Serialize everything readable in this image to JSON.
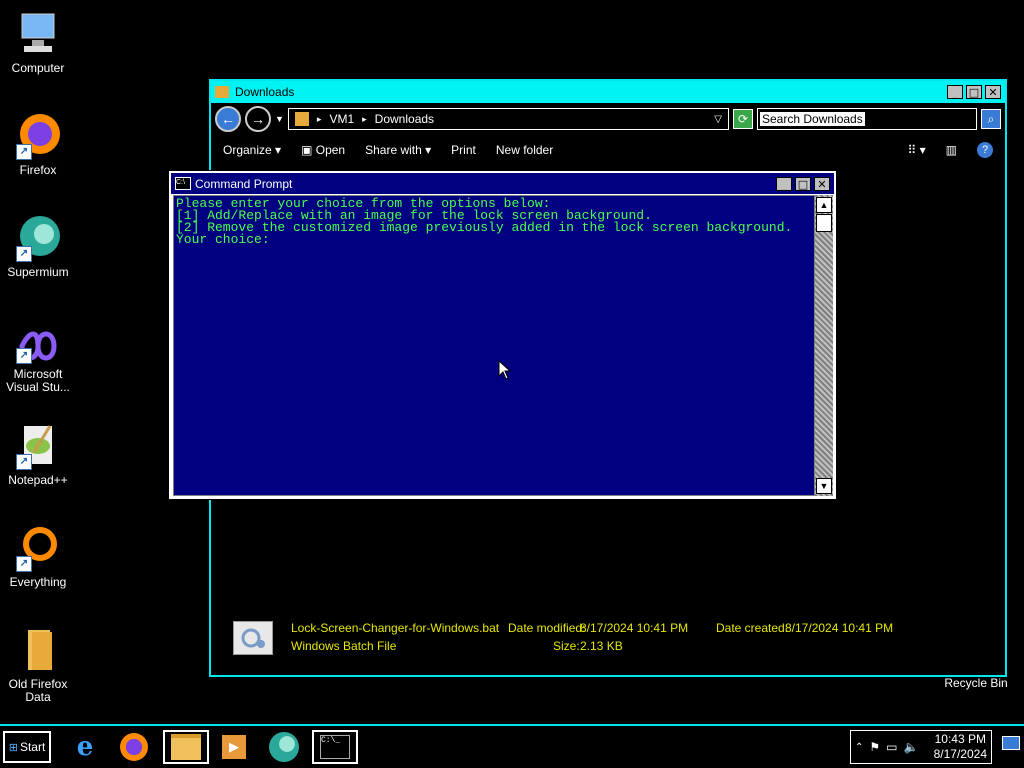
{
  "desktop": {
    "icons": [
      {
        "label": "Computer"
      },
      {
        "label": "Firefox"
      },
      {
        "label": "Supermium"
      },
      {
        "label": "Microsoft Visual Stu..."
      },
      {
        "label": "Notepad++"
      },
      {
        "label": "Everything"
      },
      {
        "label": "Old Firefox Data"
      }
    ],
    "recycle_bin": "Recycle Bin"
  },
  "explorer": {
    "title": "Downloads",
    "breadcrumb": [
      "VM1",
      "Downloads"
    ],
    "search_placeholder": "Search Downloads",
    "toolbar": {
      "organize": "Organize",
      "open": "Open",
      "share": "Share with",
      "print": "Print",
      "new_folder": "New folder"
    },
    "file": {
      "name": "Lock-Screen-Changer-for-Windows.bat",
      "type": "Windows Batch File",
      "modified_label": "Date modified:",
      "modified": "8/17/2024 10:41 PM",
      "created_label": "Date created:",
      "created": "8/17/2024 10:41 PM",
      "size_label": "Size:",
      "size": "2.13 KB"
    }
  },
  "cmd": {
    "title": "Command Prompt",
    "lines": [
      "Please enter your choice from the options below:",
      "[1] Add/Replace with an image for the lock screen background.",
      "[2] Remove the customized image previously added in the lock screen background.",
      "Your choice:"
    ]
  },
  "taskbar": {
    "start": "Start",
    "time": "10:43 PM",
    "date": "8/17/2024"
  },
  "colors": {
    "accent": "#00f3f3",
    "cmd_bg": "#000080",
    "cmd_text": "#4cff4c",
    "file_text": "#e6e600"
  }
}
